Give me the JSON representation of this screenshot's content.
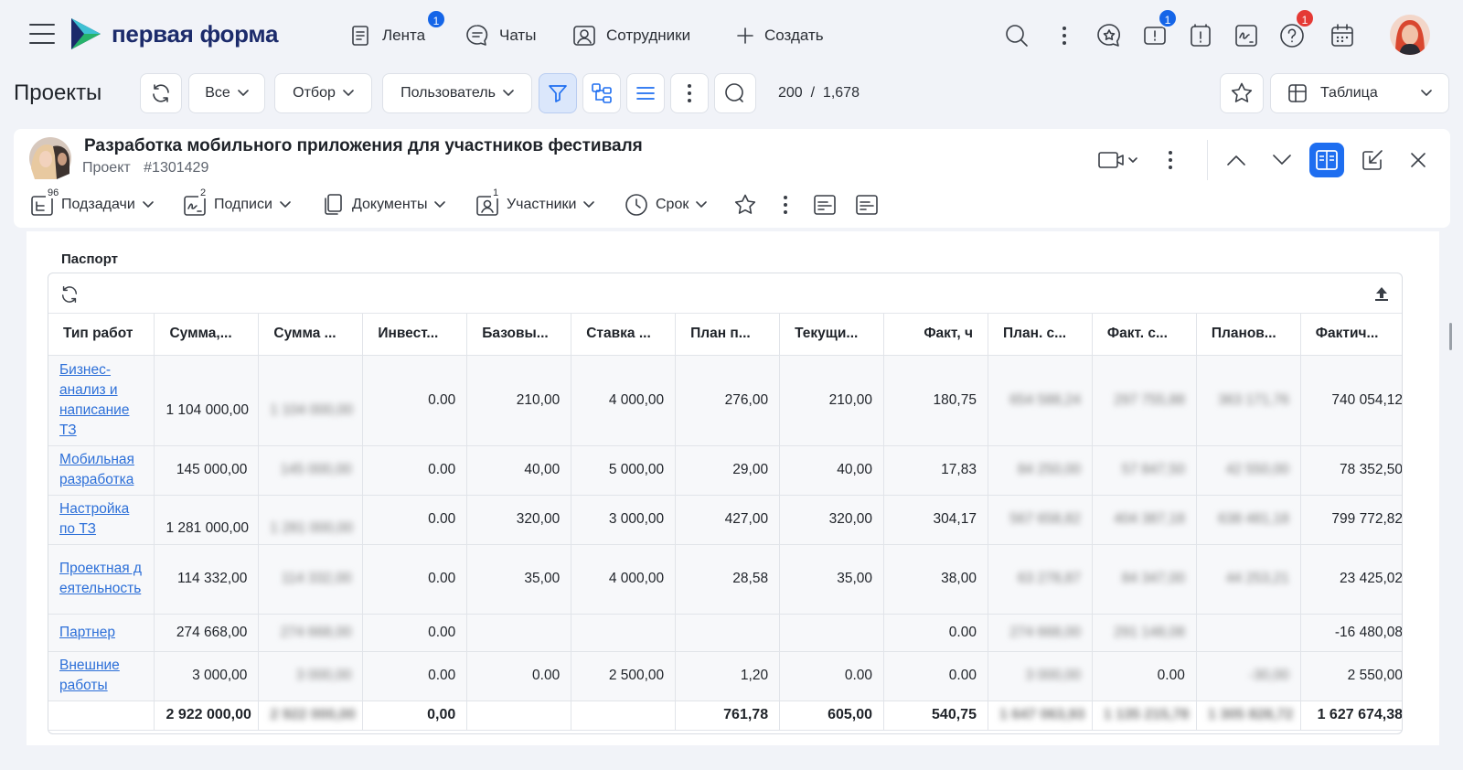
{
  "app": {
    "logo_text": "первая форма",
    "nav": [
      {
        "label": "Лента",
        "icon": "feed-icon",
        "badge": "1"
      },
      {
        "label": "Чаты",
        "icon": "chat-icon"
      },
      {
        "label": "Сотрудники",
        "icon": "employees-icon"
      },
      {
        "label": "Создать",
        "icon": "plus-icon"
      }
    ],
    "badges": {
      "tasks": "1",
      "help": "1"
    }
  },
  "toolbar": {
    "page_title": "Проекты",
    "filter_all": "Все",
    "filter_selection": "Отбор",
    "filter_user": "Пользователь",
    "counter": "200  /  1,678",
    "view_label": "Таблица"
  },
  "card": {
    "title": "Разработка мобильного приложения для участников фестиваля",
    "type": "Проект",
    "id": "#1301429",
    "tabs": [
      {
        "label": "Подзадачи",
        "count": "96"
      },
      {
        "label": "Подписи",
        "count": "2"
      },
      {
        "label": "Документы",
        "count": ""
      },
      {
        "label": "Участники",
        "count": "1"
      },
      {
        "label": "Срок",
        "count": ""
      }
    ]
  },
  "passport": {
    "section_title": "Паспорт",
    "columns": [
      "Тип работ",
      "Сумма,...",
      "Сумма ...",
      "Инвест...",
      "Базовы...",
      "Ставка ...",
      "План п...",
      "Текущи...",
      "Факт, ч",
      "План. с...",
      "Факт. с...",
      "Планов...",
      "Фактич..."
    ],
    "rows": [
      {
        "name": "Бизнес-анализ и написание ТЗ",
        "c1": "1 104 000,00",
        "c2": "1 104 000,00",
        "c3": "0.00",
        "c4": "210,00",
        "c5": "4 000,00",
        "c6": "276,00",
        "c7": "210,00",
        "c8": "180,75",
        "c9": "654 588,24",
        "c10": "297 755,88",
        "c11": "363 171,76",
        "c12": "740 054,12"
      },
      {
        "name": "Мобильная разработка",
        "c1": "145 000,00",
        "c2": "145 000,00",
        "c3": "0.00",
        "c4": "40,00",
        "c5": "5 000,00",
        "c6": "29,00",
        "c7": "40,00",
        "c8": "17,83",
        "c9": "84 250,00",
        "c10": "57 847,50",
        "c11": "42 550,00",
        "c12": "78 352,50"
      },
      {
        "name": "Настройка по ТЗ",
        "c1": "1 281 000,00",
        "c2": "1 281 000,00",
        "c3": "0.00",
        "c4": "320,00",
        "c5": "3 000,00",
        "c6": "427,00",
        "c7": "320,00",
        "c8": "304,17",
        "c9": "567 658,82",
        "c10": "404 387,18",
        "c11": "638 481,18",
        "c12": "799 772,82"
      },
      {
        "name": "Проектная деятельность",
        "c1": "114 332,00",
        "c2": "114 332,00",
        "c3": "0.00",
        "c4": "35,00",
        "c5": "4 000,00",
        "c6": "28,58",
        "c7": "35,00",
        "c8": "38,00",
        "c9": "63 278,87",
        "c10": "84 347,00",
        "c11": "44 253,21",
        "c12": "23 425,02"
      },
      {
        "name": "Партнер",
        "c1": "274 668,00",
        "c2": "274 668,00",
        "c3": "0.00",
        "c4": "",
        "c5": "",
        "c6": "",
        "c7": "",
        "c8": "0.00",
        "c9": "274 668,00",
        "c10": "291 148,08",
        "c11": "",
        "c12": "-16 480,08"
      },
      {
        "name": "Внешние работы",
        "c1": "3 000,00",
        "c2": "3 000,00",
        "c3": "0.00",
        "c4": "0.00",
        "c5": "2 500,00",
        "c6": "1,20",
        "c7": "0.00",
        "c8": "0.00",
        "c9": "3 000,00",
        "c10": "0.00",
        "c11": "-30,00",
        "c12": "2 550,00"
      }
    ],
    "totals": {
      "c1": "2 922 000,00",
      "c2": "2 922 000,00",
      "c3": "0,00",
      "c4": "",
      "c5": "",
      "c6": "761,78",
      "c7": "605,00",
      "c8": "540,75",
      "c9": "1 647 063,93",
      "c10": "1 135 215,78",
      "c11": "1 305 828,72",
      "c12": "1 627 674,38"
    }
  }
}
